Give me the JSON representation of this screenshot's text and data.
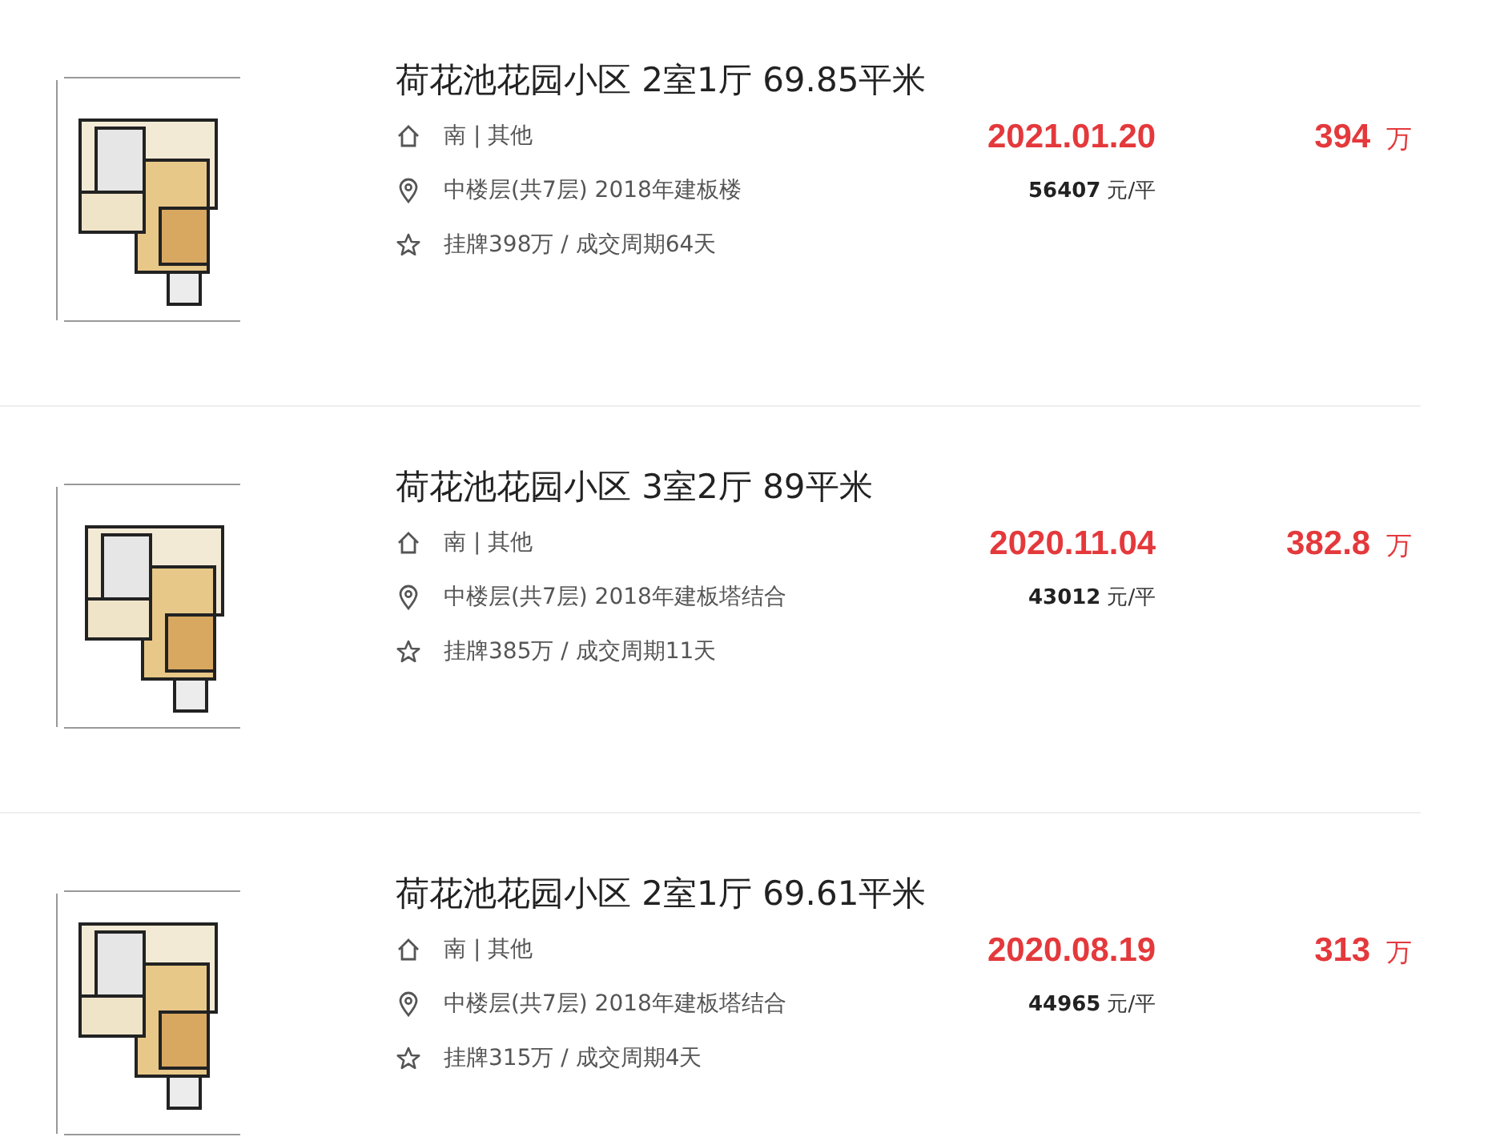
{
  "listings": [
    {
      "kind": "picture",
      "title": "荷花池花园小区 2室1厅 69.85平米",
      "orientation": "南 | 其他",
      "floor": "中楼层(共7层) 2018年建板楼",
      "listing": "挂牌398万 / 成交周期64天",
      "date": "2021.01.20",
      "price": "394",
      "price_unit": "万",
      "unit_price": "56407",
      "unit_price_unit": "元/平"
    },
    {
      "kind": "picture",
      "title": "荷花池花园小区 3室2厅 89平米",
      "orientation": "南 | 其他",
      "floor": "中楼层(共7层) 2018年建板塔结合",
      "listing": "挂牌385万 / 成交周期11天",
      "date": "2020.11.04",
      "price": "382.8",
      "price_unit": "万",
      "unit_price": "43012",
      "unit_price_unit": "元/平"
    },
    {
      "kind": "picture",
      "title": "荷花池花园小区 2室1厅 69.61平米",
      "orientation": "南 | 其他",
      "floor": "中楼层(共7层) 2018年建板塔结合",
      "listing": "挂牌315万 / 成交周期4天",
      "date": "2020.08.19",
      "price": "313",
      "price_unit": "万",
      "unit_price": "44965",
      "unit_price_unit": "元/平"
    }
  ]
}
